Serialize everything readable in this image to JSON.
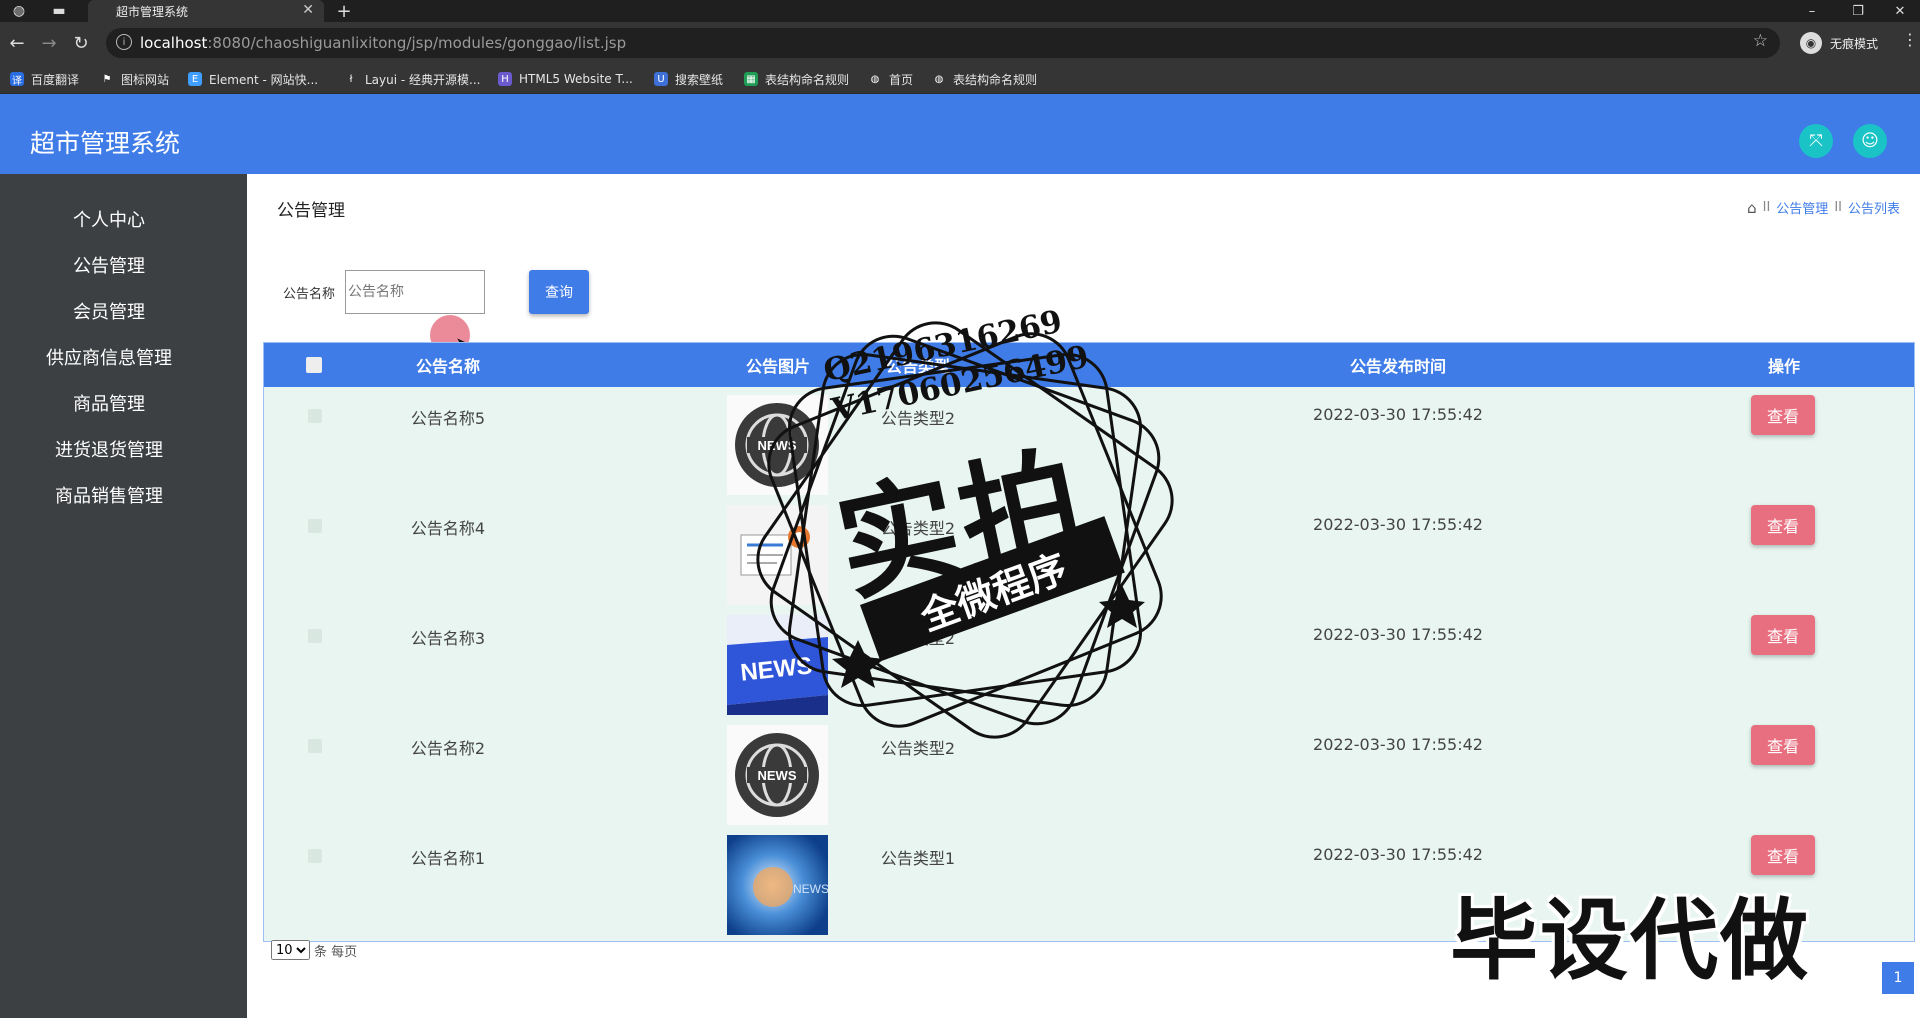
{
  "browser": {
    "tab_title": "超市管理系统",
    "new_tab": "+",
    "url_host": "localhost",
    "url_rest": ":8080/chaoshiguanlixitong/jsp/modules/gonggao/list.jsp",
    "profile_label": "无痕模式",
    "bookmarks": [
      "百度翻译",
      "图标网站",
      "Element - 网站快...",
      "Layui - 经典开源模...",
      "HTML5 Website T...",
      "搜索壁纸",
      "表结构命名规则",
      "首页",
      "表结构命名规则"
    ]
  },
  "app": {
    "title": "超市管理系统"
  },
  "sidebar": {
    "items": [
      {
        "label": "个人中心"
      },
      {
        "label": "公告管理"
      },
      {
        "label": "会员管理"
      },
      {
        "label": "供应商信息管理"
      },
      {
        "label": "商品管理"
      },
      {
        "label": "进货退货管理"
      },
      {
        "label": "商品销售管理"
      }
    ]
  },
  "page": {
    "title": "公告管理",
    "breadcrumb": [
      "公告管理",
      "公告列表"
    ],
    "breadcrumb_sep": "II"
  },
  "search": {
    "label": "公告名称",
    "placeholder": "公告名称",
    "button": "查询"
  },
  "table": {
    "headers": [
      "公告名称",
      "公告图片",
      "公告类型",
      "公告发布时间",
      "操作"
    ],
    "rows": [
      {
        "name": "公告名称5",
        "type": "公告类型2",
        "time": "2022-03-30 17:55:42",
        "action": "查看"
      },
      {
        "name": "公告名称4",
        "type": "公告类型2",
        "time": "2022-03-30 17:55:42",
        "action": "查看"
      },
      {
        "name": "公告名称3",
        "type": "公告类型2",
        "time": "2022-03-30 17:55:42",
        "action": "查看"
      },
      {
        "name": "公告名称2",
        "type": "公告类型2",
        "time": "2022-03-30 17:55:42",
        "action": "查看"
      },
      {
        "name": "公告名称1",
        "type": "公告类型1",
        "time": "2022-03-30 17:55:42",
        "action": "查看"
      }
    ]
  },
  "pager": {
    "page_size": "10",
    "page_size_suffix": "条 每页",
    "current_page": "1"
  },
  "watermark": {
    "qq": "Q2196316269",
    "vx": "V17060256499",
    "big": "实拍",
    "band": "全微程序",
    "corner": "毕设代做"
  },
  "colors": {
    "header": "#3f7ce8",
    "sidebar": "#3d4043",
    "view_button": "#e76f7f",
    "icon_button": "#19c3c6"
  }
}
